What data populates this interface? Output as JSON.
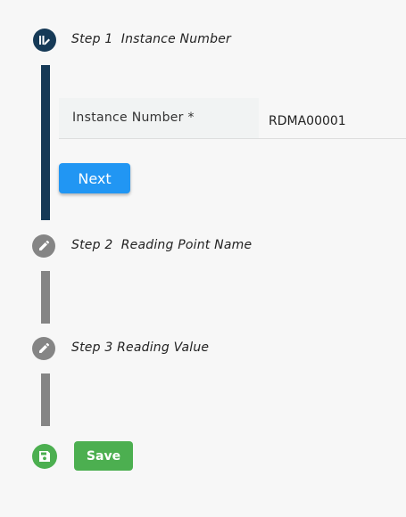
{
  "colors": {
    "active": "#163a57",
    "inactive": "#858585",
    "primary_button": "#2196f3",
    "save_green": "#4caf50"
  },
  "steps": [
    {
      "number_label": "Step 1",
      "name": "Instance Number",
      "title": "Step 1  Instance Number",
      "icon": "step-active-icon",
      "state": "active"
    },
    {
      "number_label": "Step 2",
      "name": "Reading Point Name",
      "title": "Step 2  Reading Point Name",
      "icon": "pencil-icon",
      "state": "pending"
    },
    {
      "number_label": "Step 3",
      "name": "Reading Value",
      "title": "Step 3 Reading Value",
      "icon": "pencil-icon",
      "state": "pending"
    }
  ],
  "form": {
    "instance_label": "Instance Number *",
    "instance_value": "RDMA00001"
  },
  "buttons": {
    "next_label": "Next",
    "save_label": "Save"
  },
  "icons": {
    "save": "floppy-disk-icon"
  }
}
